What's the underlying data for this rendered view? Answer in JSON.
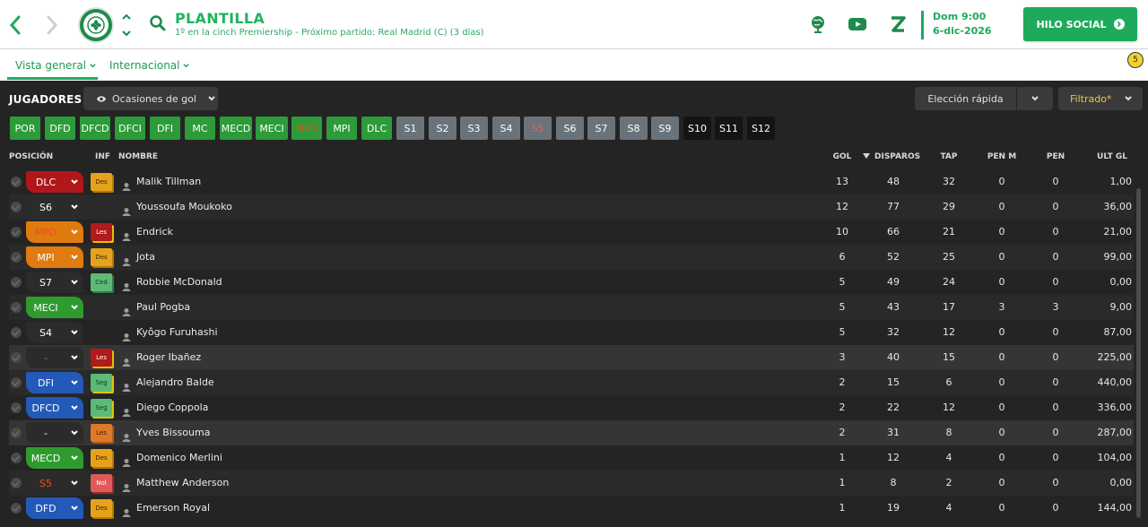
{
  "header": {
    "title": "PLANTILLA",
    "subtitle": "1º en la cinch Premiership - Próximo partido: Real Madrid (C)  (3 días)",
    "date_day": "Dom 9:00",
    "date_date": "6-dic-2026",
    "social_button": "HILO SOCIAL",
    "icons": [
      "back-arrow-icon",
      "forward-arrow-icon",
      "club-badge-icon",
      "search-icon",
      "globe-icon",
      "youtube-icon",
      "z-icon"
    ]
  },
  "tabs": [
    {
      "label": "Vista general"
    },
    {
      "label": "Internacional"
    }
  ],
  "notification_count": "5",
  "toolbar": {
    "title": "JUGADORES",
    "view_dropdown": "Ocasiones de gol",
    "quick_select": "Elección rápida",
    "filter": "Filtrado*"
  },
  "position_filters": [
    "POR",
    "DFD",
    "DFCD",
    "DFCI",
    "DFI",
    "MC",
    "MECD",
    "MECI",
    "MPD",
    "MPI",
    "DLC",
    "S1",
    "S2",
    "S3",
    "S4",
    "S5",
    "S6",
    "S7",
    "S8",
    "S9",
    "S10",
    "S11",
    "S12"
  ],
  "columns": {
    "posicion": "POSICIÓN",
    "inf": "INF",
    "nombre": "NOMBRE",
    "gol": "GOL",
    "disparos": "DISPAROS",
    "tap": "TAP",
    "penm": "PEN M",
    "pen": "PEN",
    "ultgl": "ULT GL"
  },
  "rows": [
    {
      "pos": "DLC",
      "inf": "Des",
      "name": "Malik Tillman",
      "gol": "13",
      "disparos": "48",
      "tap": "32",
      "penm": "0",
      "pen": "0",
      "ultgl": "1,00"
    },
    {
      "pos": "S6",
      "inf": "",
      "name": "Youssoufa Moukoko",
      "gol": "12",
      "disparos": "77",
      "tap": "29",
      "penm": "0",
      "pen": "0",
      "ultgl": "36,00"
    },
    {
      "pos": "MPD",
      "inf": "Les",
      "name": "Endrick",
      "gol": "10",
      "disparos": "66",
      "tap": "21",
      "penm": "0",
      "pen": "0",
      "ultgl": "21,00"
    },
    {
      "pos": "MPI",
      "inf": "Des",
      "name": "Jota",
      "gol": "6",
      "disparos": "52",
      "tap": "25",
      "penm": "0",
      "pen": "0",
      "ultgl": "99,00"
    },
    {
      "pos": "S7",
      "inf": "Ced",
      "name": "Robbie McDonald",
      "gol": "5",
      "disparos": "49",
      "tap": "24",
      "penm": "0",
      "pen": "0",
      "ultgl": "0,00"
    },
    {
      "pos": "MECI",
      "inf": "",
      "name": "Paul Pogba",
      "gol": "5",
      "disparos": "43",
      "tap": "17",
      "penm": "3",
      "pen": "3",
      "ultgl": "9,00"
    },
    {
      "pos": "S4",
      "inf": "",
      "name": "Kyôgo Furuhashi",
      "gol": "5",
      "disparos": "32",
      "tap": "12",
      "penm": "0",
      "pen": "0",
      "ultgl": "87,00"
    },
    {
      "pos": "-",
      "inf": "Les",
      "name": "Roger Ibañez",
      "gol": "3",
      "disparos": "40",
      "tap": "15",
      "penm": "0",
      "pen": "0",
      "ultgl": "225,00"
    },
    {
      "pos": "DFI",
      "inf": "Seg",
      "name": "Alejandro Balde",
      "gol": "2",
      "disparos": "15",
      "tap": "6",
      "penm": "0",
      "pen": "0",
      "ultgl": "440,00"
    },
    {
      "pos": "DFCD",
      "inf": "Seg",
      "name": "Diego Coppola",
      "gol": "2",
      "disparos": "22",
      "tap": "12",
      "penm": "0",
      "pen": "0",
      "ultgl": "336,00"
    },
    {
      "pos": "-",
      "inf": "Les",
      "name": "Yves Bissouma",
      "gol": "2",
      "disparos": "31",
      "tap": "8",
      "penm": "0",
      "pen": "0",
      "ultgl": "287,00"
    },
    {
      "pos": "MECD",
      "inf": "Des",
      "name": "Domenico Merlini",
      "gol": "1",
      "disparos": "12",
      "tap": "4",
      "penm": "0",
      "pen": "0",
      "ultgl": "104,00"
    },
    {
      "pos": "S5",
      "inf": "Nol",
      "name": "Matthew Anderson",
      "gol": "1",
      "disparos": "8",
      "tap": "2",
      "penm": "0",
      "pen": "0",
      "ultgl": "0,00"
    },
    {
      "pos": "DFD",
      "inf": "Des",
      "name": "Emerson Royal",
      "gol": "1",
      "disparos": "19",
      "tap": "4",
      "penm": "0",
      "pen": "0",
      "ultgl": "144,00"
    }
  ]
}
